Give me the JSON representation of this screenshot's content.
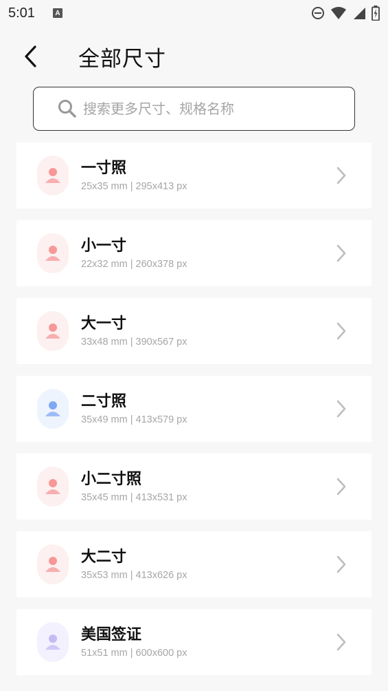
{
  "status_bar": {
    "time": "5:01",
    "a_badge": "A"
  },
  "header": {
    "title": "全部尺寸"
  },
  "search": {
    "placeholder": "搜索更多尺寸、规格名称"
  },
  "items": [
    {
      "name": "一寸照",
      "spec": "25x35 mm | 295x413 px",
      "avatar_color": "pink"
    },
    {
      "name": "小一寸",
      "spec": "22x32 mm | 260x378 px",
      "avatar_color": "pink"
    },
    {
      "name": "大一寸",
      "spec": "33x48 mm | 390x567 px",
      "avatar_color": "pink"
    },
    {
      "name": "二寸照",
      "spec": "35x49 mm | 413x579 px",
      "avatar_color": "blue"
    },
    {
      "name": "小二寸照",
      "spec": "35x45 mm | 413x531 px",
      "avatar_color": "pink"
    },
    {
      "name": "大二寸",
      "spec": "35x53 mm | 413x626 px",
      "avatar_color": "pink"
    },
    {
      "name": "美国签证",
      "spec": "51x51 mm | 600x600 px",
      "avatar_color": "lavender"
    }
  ],
  "colors": {
    "pink": "#f47a7a",
    "blue": "#5b8ef0",
    "lavender": "#b3a8f0"
  }
}
